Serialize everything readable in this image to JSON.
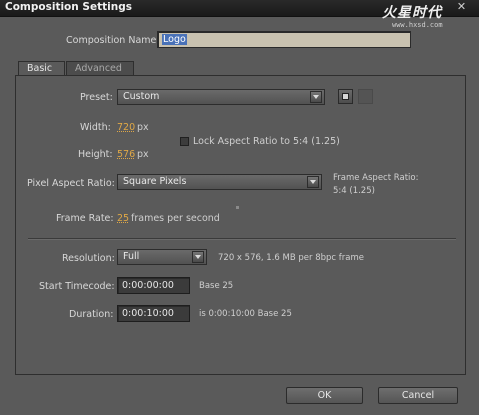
{
  "window": {
    "title": "Composition Settings",
    "close_glyph": "✕"
  },
  "watermark": {
    "brand": "火星时代",
    "url": "www.hxsd.com"
  },
  "composition_name": {
    "label": "Composition Name:",
    "value": "Logo"
  },
  "tabs": [
    {
      "label": "Basic",
      "active": true
    },
    {
      "label": "Advanced",
      "active": false
    }
  ],
  "preset": {
    "label": "Preset:",
    "value": "Custom",
    "save_icon": "save-disk-icon",
    "delete_icon": "trash-icon"
  },
  "width": {
    "label": "Width:",
    "value": "720",
    "unit": "px"
  },
  "height": {
    "label": "Height:",
    "value": "576",
    "unit": "px"
  },
  "lock_aspect": {
    "label": "Lock Aspect Ratio to 5:4 (1.25)",
    "checked": false
  },
  "pixel_aspect": {
    "label": "Pixel Aspect Ratio:",
    "value": "Square Pixels",
    "frame_aspect_label": "Frame Aspect Ratio:",
    "frame_aspect_value": "5:4 (1.25)"
  },
  "frame_rate": {
    "label": "Frame Rate:",
    "value": "25",
    "unit": "frames per second"
  },
  "resolution": {
    "label": "Resolution:",
    "value": "Full",
    "info": "720 x 576, 1.6 MB per 8bpc frame"
  },
  "start_timecode": {
    "label": "Start Timecode:",
    "value": "0:00:00:00",
    "info": "Base 25"
  },
  "duration": {
    "label": "Duration:",
    "value": "0:00:10:00",
    "info": "is 0:00:10:00  Base 25"
  },
  "buttons": {
    "ok": "OK",
    "cancel": "Cancel"
  },
  "colors": {
    "accent_value": "#e0a846",
    "background": "#5a5a5a",
    "selection": "#4a72b8"
  }
}
